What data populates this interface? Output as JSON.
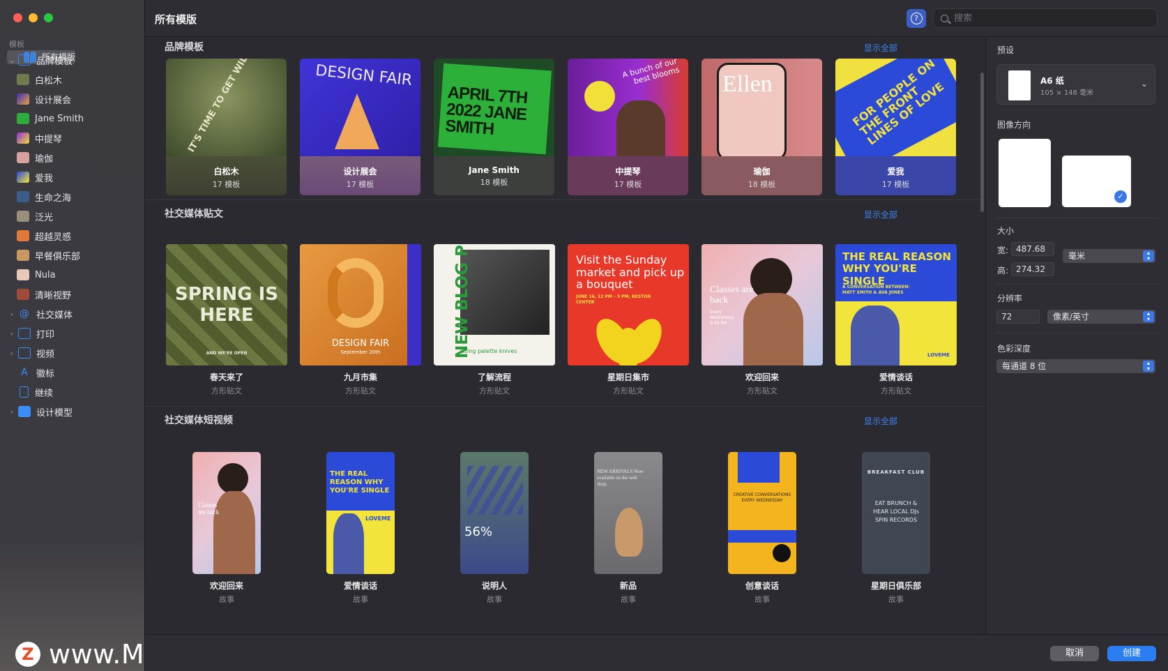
{
  "window": {
    "title": "所有模版"
  },
  "search": {
    "placeholder": "搜索"
  },
  "sidebar": {
    "header": "模板",
    "items": [
      {
        "label": "所有模版",
        "selected": true
      },
      {
        "label": "品牌模板",
        "expanded": true
      },
      {
        "label": "白松木"
      },
      {
        "label": "设计展会"
      },
      {
        "label": "Jane Smith"
      },
      {
        "label": "中提琴"
      },
      {
        "label": "瑜伽"
      },
      {
        "label": "爱我"
      },
      {
        "label": "生命之海"
      },
      {
        "label": "泛光"
      },
      {
        "label": "超越灵感"
      },
      {
        "label": "早餐俱乐部"
      },
      {
        "label": "Nula"
      },
      {
        "label": "清晰视野"
      },
      {
        "label": "社交媒体"
      },
      {
        "label": "打印"
      },
      {
        "label": "视频"
      },
      {
        "label": "徽标"
      },
      {
        "label": "继续"
      },
      {
        "label": "设计模型"
      }
    ]
  },
  "sections": {
    "brand": {
      "title": "品牌模板",
      "show_all": "显示全部",
      "cards": [
        {
          "name": "白松木",
          "count": "17 模板",
          "art": "IT'S TIME TO GET WILD"
        },
        {
          "name": "设计展会",
          "count": "17 模板",
          "art": "DESIGN FAIR"
        },
        {
          "name": "Jane Smith",
          "count": "18 模板",
          "art": "APRIL 7TH 2022 JANE SMITH"
        },
        {
          "name": "中提琴",
          "count": "17 模板",
          "art": "A bunch of our best blooms"
        },
        {
          "name": "瑜伽",
          "count": "18 模板",
          "art": "Ellen"
        },
        {
          "name": "爱我",
          "count": "17 模板",
          "art": "FOR PEOPLE ON THE FRONT LINES OF LOVE"
        }
      ]
    },
    "social_posts": {
      "title": "社交媒体贴文",
      "show_all": "显示全部",
      "cards": [
        {
          "name": "春天来了",
          "kind": "方形贴文",
          "art": "SPRING IS HERE",
          "art_sub": "AND WE'RE OPEN"
        },
        {
          "name": "九月市集",
          "kind": "方形贴文",
          "art": "DESIGN FAIR",
          "art_sub": "September 20th"
        },
        {
          "name": "了解流程",
          "kind": "方形贴文",
          "art": "NEW BLOG POST",
          "art_sub": "Using palette knives"
        },
        {
          "name": "星期日集市",
          "kind": "方形贴文",
          "art": "Visit the Sunday market and pick up a bouquet",
          "art_sub": "JUNE 16, 12 PM – 5 PM, RESTON CENTER"
        },
        {
          "name": "欢迎回来",
          "kind": "方形贴文",
          "art": "Classes are back",
          "art_sub": "Every Wednesday 6:30 PM"
        },
        {
          "name": "爱情谈话",
          "kind": "方形贴文",
          "art": "THE REAL REASON WHY YOU'RE SINGLE",
          "art_sub": "A CONVERSATION BETWEEN: MATT SMITH & AVA JONES",
          "art_brand": "LOVEME"
        }
      ]
    },
    "social_videos": {
      "title": "社交媒体短视频",
      "show_all": "显示全部",
      "cards": [
        {
          "name": "欢迎回来",
          "kind": "故事",
          "art": "Classes are back"
        },
        {
          "name": "爱情谈话",
          "kind": "故事",
          "art": "THE REAL REASON WHY YOU'RE SINGLE",
          "art_brand": "LOVEME"
        },
        {
          "name": "说明人",
          "kind": "故事",
          "art": "56%"
        },
        {
          "name": "新品",
          "kind": "故事",
          "art": "NEW ARRIVALS Now available on the web shop."
        },
        {
          "name": "创意谈话",
          "kind": "故事",
          "art": "CREATIVE CONVERSATIONS EVERY WEDNESDAY"
        },
        {
          "name": "星期日俱乐部",
          "kind": "故事",
          "art": "BREAKFAST CLUB",
          "art_sub": "EAT BRUNCH & HEAR LOCAL DJs SPIN RECORDS"
        }
      ]
    }
  },
  "panel": {
    "preset_label": "预设",
    "preset_name": "A6 纸",
    "preset_dims": "105 × 148 毫米",
    "orientation_label": "图像方向",
    "orientation_selected": "landscape",
    "size_label": "大小",
    "width_label": "宽:",
    "width_value": "487.68",
    "height_label": "高:",
    "height_value": "274.32",
    "unit": "毫米",
    "resolution_label": "分辨率",
    "resolution_value": "72",
    "resolution_unit": "像素/英寸",
    "color_depth_label": "色彩深度",
    "color_depth_value": "每通道 8 位"
  },
  "buttons": {
    "cancel": "取消",
    "create": "创建"
  },
  "watermark": {
    "logo": "Z",
    "text": "www.MacZ.com"
  },
  "colors": {
    "accent": "#3b78e7",
    "link": "#3b86f5",
    "selected_row": "#55555c"
  }
}
